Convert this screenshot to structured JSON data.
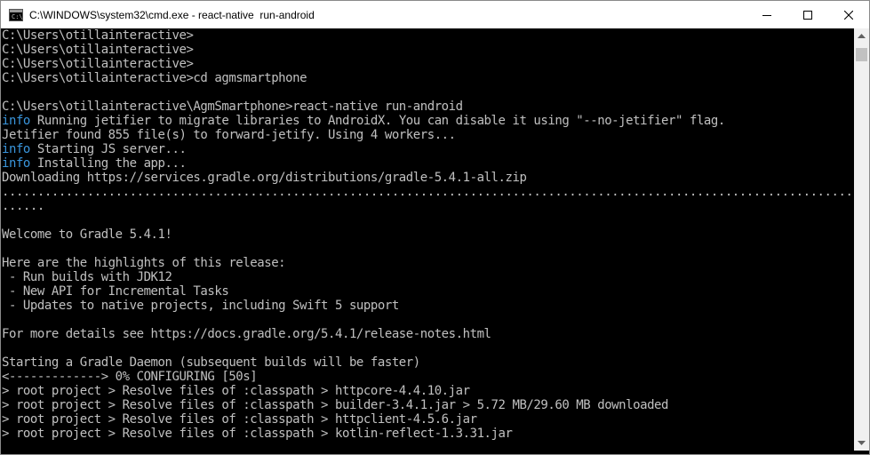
{
  "window": {
    "title": "C:\\WINDOWS\\system32\\cmd.exe - react-native  run-android",
    "icon_text": "C:\\"
  },
  "icons": {
    "app": "cmd-icon",
    "minimize": "minimize-icon",
    "maximize": "maximize-icon",
    "close": "close-icon"
  },
  "colors": {
    "console_bg": "#000000",
    "console_text": "#c0c0c0",
    "info_tag": "#3a96dd"
  },
  "console": {
    "lines": [
      {
        "tag": "",
        "text": "C:\\Users\\otillainteractive>"
      },
      {
        "tag": "",
        "text": "C:\\Users\\otillainteractive>"
      },
      {
        "tag": "",
        "text": "C:\\Users\\otillainteractive>"
      },
      {
        "tag": "",
        "text": "C:\\Users\\otillainteractive>cd agmsmartphone"
      },
      {
        "tag": "",
        "text": ""
      },
      {
        "tag": "",
        "text": "C:\\Users\\otillainteractive\\AgmSmartphone>react-native run-android"
      },
      {
        "tag": "info",
        "text": " Running jetifier to migrate libraries to AndroidX. You can disable it using \"--no-jetifier\" flag."
      },
      {
        "tag": "",
        "text": "Jetifier found 855 file(s) to forward-jetify. Using 4 workers..."
      },
      {
        "tag": "info",
        "text": " Starting JS server..."
      },
      {
        "tag": "info",
        "text": " Installing the app..."
      },
      {
        "tag": "",
        "text": "Downloading https://services.gradle.org/distributions/gradle-5.4.1-all.zip"
      },
      {
        "tag": "",
        "text": "....................................................................................................................................."
      },
      {
        "tag": "",
        "text": "......"
      },
      {
        "tag": "",
        "text": ""
      },
      {
        "tag": "",
        "text": "Welcome to Gradle 5.4.1!"
      },
      {
        "tag": "",
        "text": ""
      },
      {
        "tag": "",
        "text": "Here are the highlights of this release:"
      },
      {
        "tag": "",
        "text": " - Run builds with JDK12"
      },
      {
        "tag": "",
        "text": " - New API for Incremental Tasks"
      },
      {
        "tag": "",
        "text": " - Updates to native projects, including Swift 5 support"
      },
      {
        "tag": "",
        "text": ""
      },
      {
        "tag": "",
        "text": "For more details see https://docs.gradle.org/5.4.1/release-notes.html"
      },
      {
        "tag": "",
        "text": ""
      },
      {
        "tag": "",
        "text": "Starting a Gradle Daemon (subsequent builds will be faster)"
      },
      {
        "tag": "",
        "text": "<-------------> 0% CONFIGURING [50s]"
      },
      {
        "tag": "",
        "text": "> root project > Resolve files of :classpath > httpcore-4.4.10.jar"
      },
      {
        "tag": "",
        "text": "> root project > Resolve files of :classpath > builder-3.4.1.jar > 5.72 MB/29.60 MB downloaded"
      },
      {
        "tag": "",
        "text": "> root project > Resolve files of :classpath > httpclient-4.5.6.jar"
      },
      {
        "tag": "",
        "text": "> root project > Resolve files of :classpath > kotlin-reflect-1.3.31.jar"
      }
    ]
  }
}
